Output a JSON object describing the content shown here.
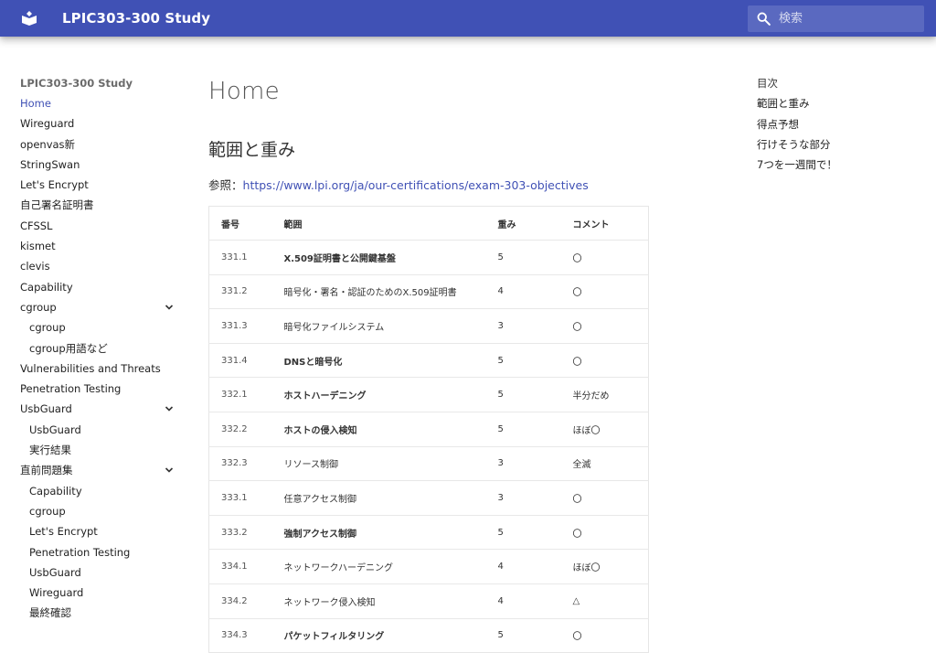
{
  "header": {
    "site_title": "LPIC303-300 Study",
    "search_placeholder": "検索",
    "brand_color": "#4051b5"
  },
  "nav": {
    "title": "LPIC303-300 Study",
    "items": [
      {
        "label": "Home",
        "active": true
      },
      {
        "label": "Wireguard"
      },
      {
        "label": "openvas新"
      },
      {
        "label": "StringSwan"
      },
      {
        "label": "Let's Encrypt"
      },
      {
        "label": "自己署名証明書"
      },
      {
        "label": "CFSSL"
      },
      {
        "label": "kismet"
      },
      {
        "label": "clevis"
      },
      {
        "label": "Capability"
      },
      {
        "label": "cgroup",
        "expandable": true
      },
      {
        "label": "cgroup",
        "child": true
      },
      {
        "label": "cgroup用語など",
        "child": true
      },
      {
        "label": "Vulnerabilities and Threats"
      },
      {
        "label": "Penetration Testing"
      },
      {
        "label": "UsbGuard",
        "expandable": true
      },
      {
        "label": "UsbGuard",
        "child": true
      },
      {
        "label": "実行結果",
        "child": true
      },
      {
        "label": "直前問題集",
        "expandable": true
      },
      {
        "label": "Capability",
        "child": true
      },
      {
        "label": "cgroup",
        "child": true
      },
      {
        "label": "Let's Encrypt",
        "child": true
      },
      {
        "label": "Penetration Testing",
        "child": true
      },
      {
        "label": "UsbGuard",
        "child": true
      },
      {
        "label": "Wireguard",
        "child": true
      },
      {
        "label": "最終確認",
        "child": true
      }
    ]
  },
  "main": {
    "page_title": "Home",
    "section_title": "範囲と重み",
    "ref_label": "参照：",
    "ref_link": "https://www.lpi.org/ja/our-certifications/exam-303-objectives",
    "table": {
      "headers": [
        "番号",
        "範囲",
        "重み",
        "コメント"
      ],
      "rows": [
        {
          "no": "331.1",
          "topic": "X.509証明書と公開鍵基盤",
          "weight": "5",
          "comment": "〇",
          "bold": true
        },
        {
          "no": "331.2",
          "topic": "暗号化・署名・認証のためのX.509証明書",
          "weight": "4",
          "comment": "〇",
          "bold": false
        },
        {
          "no": "331.3",
          "topic": "暗号化ファイルシステム",
          "weight": "3",
          "comment": "〇",
          "bold": false
        },
        {
          "no": "331.4",
          "topic": "DNSと暗号化",
          "weight": "5",
          "comment": "〇",
          "bold": true
        },
        {
          "no": "332.1",
          "topic": "ホストハーデニング",
          "weight": "5",
          "comment": "半分だめ",
          "bold": true
        },
        {
          "no": "332.2",
          "topic": "ホストの侵入検知",
          "weight": "5",
          "comment": "ほぼ〇",
          "bold": true
        },
        {
          "no": "332.3",
          "topic": "リソース制御",
          "weight": "3",
          "comment": "全滅",
          "bold": false
        },
        {
          "no": "333.1",
          "topic": "任意アクセス制御",
          "weight": "3",
          "comment": "〇",
          "bold": false
        },
        {
          "no": "333.2",
          "topic": "強制アクセス制御",
          "weight": "5",
          "comment": "〇",
          "bold": true
        },
        {
          "no": "334.1",
          "topic": "ネットワークハーデニング",
          "weight": "4",
          "comment": "ほぼ〇",
          "bold": false
        },
        {
          "no": "334.2",
          "topic": "ネットワーク侵入検知",
          "weight": "4",
          "comment": "△",
          "bold": false
        },
        {
          "no": "334.3",
          "topic": "パケットフィルタリング",
          "weight": "5",
          "comment": "〇",
          "bold": true
        }
      ]
    }
  },
  "toc": {
    "title": "目次",
    "items": [
      "範囲と重み",
      "得点予想",
      "行けそうな部分",
      "7つを一週間で！"
    ]
  }
}
